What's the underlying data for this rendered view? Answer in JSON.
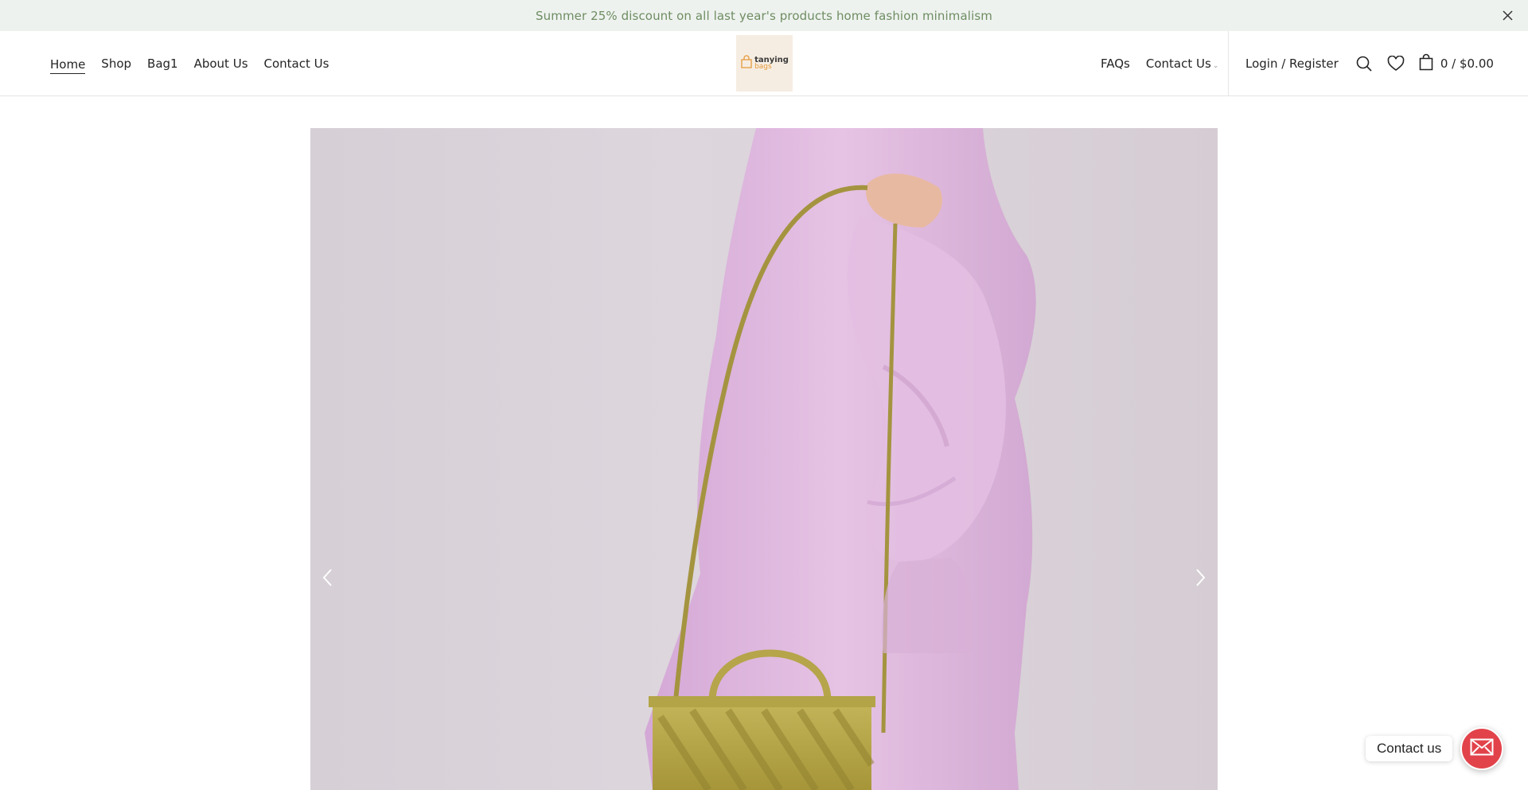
{
  "announcement": {
    "text": "Summer 25% discount on all last year's products home fashion minimalism",
    "close_icon": "close-icon"
  },
  "header": {
    "nav_left": [
      {
        "label": "Home",
        "active": true
      },
      {
        "label": "Shop"
      },
      {
        "label": "Bag1"
      },
      {
        "label": "About Us"
      },
      {
        "label": "Contact Us"
      }
    ],
    "logo": {
      "line1": "tanying",
      "line2": "bags",
      "icon": "bag-icon"
    },
    "nav_right": [
      {
        "label": "FAQs"
      },
      {
        "label": "Contact Us",
        "has_dropdown": true
      }
    ],
    "login_label": "Login / Register",
    "search_icon": "search-icon",
    "wishlist_icon": "heart-icon",
    "cart": {
      "icon": "shopping-bag-icon",
      "total": "0 / $0.00"
    }
  },
  "hero": {
    "image": "woman-in-lilac-hoodie-with-olive-handbag",
    "prev_icon": "chevron-left-icon",
    "next_icon": "chevron-right-icon"
  },
  "contact_widget": {
    "label": "Contact us",
    "icon": "envelope-icon"
  },
  "colors": {
    "announcement_bg": "#eef2ef",
    "announcement_text": "#6e8d62",
    "logo_bg": "#f6ede2",
    "logo_accent": "#e59a3c",
    "hoodie": "#dcb6dc",
    "bag": "#b8a84c",
    "contact_button": "#e2434b"
  }
}
